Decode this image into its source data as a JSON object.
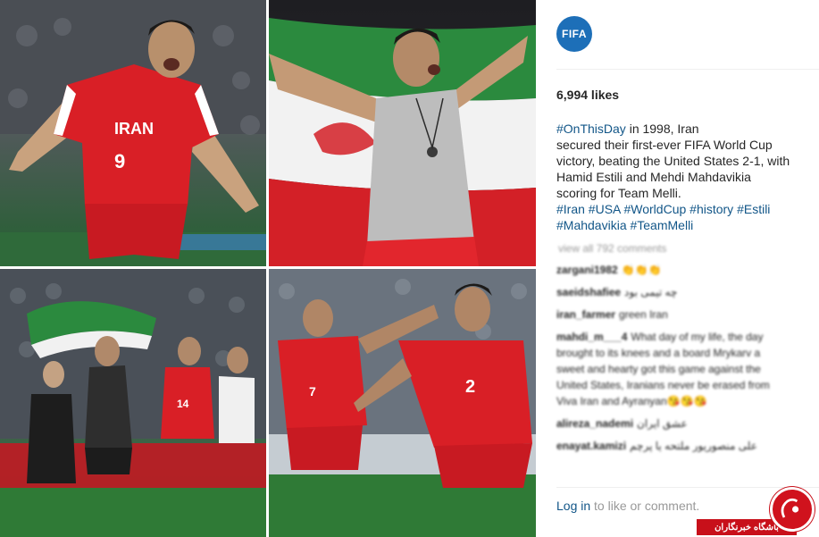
{
  "account": {
    "avatar_text": "FIFA",
    "avatar_color": "#1d6fb8"
  },
  "post": {
    "likes": "6,994 likes",
    "caption": {
      "line1_tag": "#OnThisDay",
      "line1_rest": " in 1998, Iran",
      "line2": "secured their first-ever FIFA World Cup",
      "line3": "victory, beating the United States 2-1, with",
      "line4": "Hamid Estili and Mehdi Mahdavikia",
      "line5": "scoring for Team Melli.",
      "tags_line1": "#Iran #USA #WorldCup #history #Estili",
      "tags_line2": "#Mahdavikia #TeamMelli"
    },
    "view_all": "view all 792 comments",
    "comments": [
      {
        "user": "zargani1982",
        "text": "👏👏👏"
      },
      {
        "user": "saeidshafiee",
        "text": "چه تیمی بود"
      },
      {
        "user": "iran_farmer",
        "text": "green Iran"
      },
      {
        "user": "mahdi_m___4",
        "text": "What day of my life, the day brought to its knees and a board Mrykarv a sweet and hearty got this game against the United States, Iranians never be erased from Viva Iran and Ayranyan😘😘😘"
      },
      {
        "user": "alireza_nademi",
        "text": "عشق ایران"
      },
      {
        "user": "enayat.kamizi",
        "text": "علی منصوریور ملتحه یا پرچم"
      }
    ],
    "login_link": "Log in",
    "login_rest": " to like or comment."
  },
  "photos": [
    {
      "label": "Estili celebrating in red Iran number 9 jersey"
    },
    {
      "label": "Player raising Iranian flag"
    },
    {
      "label": "Team celebrating with flag on pitch"
    },
    {
      "label": "Mahdavikia number 2 and number 7 celebrating"
    }
  ],
  "watermark": {
    "text": "باشگاه خبرنگاران"
  },
  "colors": {
    "link": "#125688",
    "muted": "#999999",
    "brand": "#1d6fb8",
    "jersey_red": "#d91f26"
  }
}
